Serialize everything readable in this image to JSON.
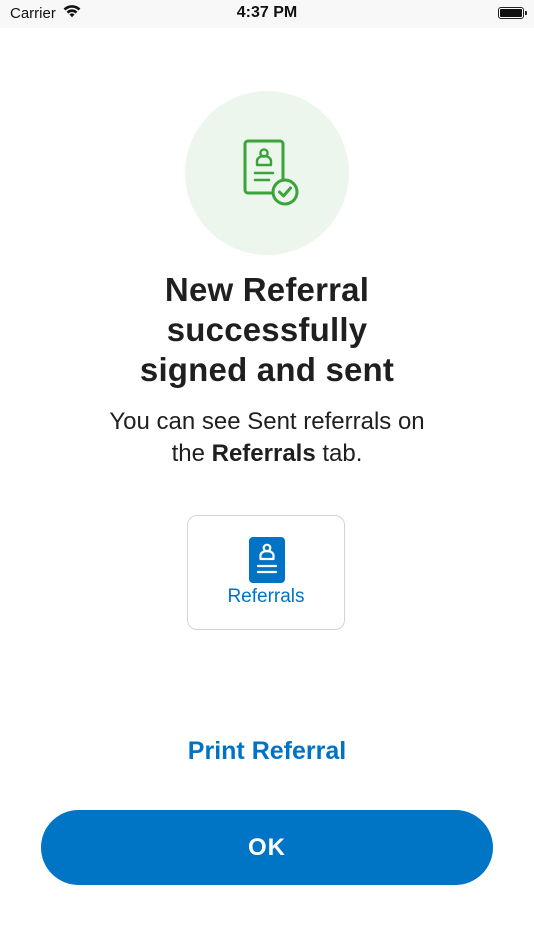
{
  "status_bar": {
    "carrier": "Carrier",
    "time": "4:37 PM",
    "battery_level": 1.0
  },
  "icons": {
    "hero": "referral-document-check-icon",
    "wifi": "wifi-icon",
    "battery": "battery-icon",
    "tile": "referral-document-icon"
  },
  "colors": {
    "accent": "#0073c4",
    "success": "#3aa33a",
    "hero_background": "#edf6ec"
  },
  "headline": {
    "line1": "New Referral",
    "line2": "successfully",
    "line3": "signed and sent"
  },
  "subtext": {
    "line1": "You can see Sent referrals on",
    "line2_prefix": "the ",
    "line2_bold": "Referrals",
    "line2_suffix": " tab."
  },
  "tile": {
    "label": "Referrals"
  },
  "actions": {
    "print_label": "Print Referral",
    "ok_label": "OK"
  }
}
